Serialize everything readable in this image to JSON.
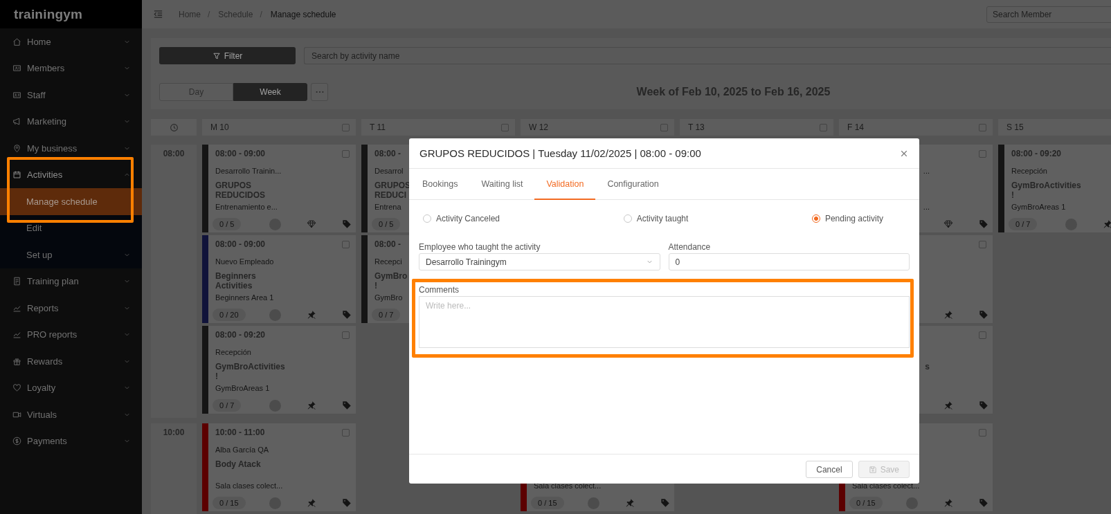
{
  "sidebar": {
    "logo": "trainingym",
    "items": [
      {
        "label": "Home",
        "expanded": false
      },
      {
        "label": "Members",
        "expanded": false
      },
      {
        "label": "Staff",
        "expanded": false
      },
      {
        "label": "Marketing",
        "expanded": false
      },
      {
        "label": "My business",
        "expanded": false
      },
      {
        "label": "Activities",
        "expanded": true,
        "highlighted": true,
        "children": [
          {
            "label": "Manage schedule",
            "selected": true
          },
          {
            "label": "Edit",
            "selected": false
          },
          {
            "label": "Set up",
            "selected": false,
            "expanded": false
          }
        ]
      },
      {
        "label": "Training plan",
        "expanded": false
      },
      {
        "label": "Reports",
        "expanded": false
      },
      {
        "label": "PRO reports",
        "expanded": false
      },
      {
        "label": "Rewards",
        "expanded": false
      },
      {
        "label": "Loyalty",
        "expanded": false
      },
      {
        "label": "Virtuals",
        "expanded": false
      },
      {
        "label": "Payments",
        "expanded": false
      }
    ]
  },
  "topbar": {
    "breadcrumbs": [
      {
        "label": "Home",
        "kind": "link"
      },
      {
        "label": "/",
        "kind": "separator"
      },
      {
        "label": "Schedule",
        "kind": "link"
      },
      {
        "label": "/",
        "kind": "separator"
      },
      {
        "label": "Manage schedule",
        "kind": "current"
      }
    ],
    "search": {
      "placeholder": "Search Member"
    }
  },
  "toolbar": {
    "filter_button": "Filter",
    "search": {
      "placeholder": "Search by activity name"
    },
    "views": [
      {
        "label": "Day",
        "selected": false
      },
      {
        "label": "Week",
        "selected": true
      }
    ],
    "week_title": "Week of Feb 10, 2025 to Feb 16, 2025"
  },
  "calendar": {
    "times": [
      "08:00",
      "10:00"
    ],
    "days": [
      {
        "label": "M 10",
        "checked": false,
        "first_slot": [
          {
            "color": "#151515",
            "checked": false,
            "time": "08:00 - 09:00",
            "trainer": "Desarrollo Trainin...",
            "name": [
              "GRUPOS",
              "REDUCIDOS"
            ],
            "area": "Entrenamiento e...",
            "count": "0 / 5",
            "icons": [
              {
                "kind": "circle"
              },
              {
                "kind": "diamond"
              },
              {
                "kind": "tag"
              }
            ]
          },
          {
            "color": "#10133a",
            "checked": false,
            "time": "08:00 - 09:00",
            "trainer": "Nuevo Empleado",
            "name": [
              "Beginners",
              "Activities"
            ],
            "area": "Beginners Area 1",
            "count": "0 / 20",
            "icons": [
              {
                "kind": "circle"
              },
              {
                "kind": "pin"
              },
              {
                "kind": "tag"
              }
            ]
          },
          {
            "color": "#151515",
            "checked": false,
            "time": "08:00 - 09:20",
            "trainer": "Recepción",
            "name": [
              "GymBroActivities",
              "!"
            ],
            "area": "GymBroAreas 1",
            "count": "0 / 7",
            "icons": [
              {
                "kind": "circle"
              },
              {
                "kind": "pin"
              },
              {
                "kind": "tag"
              }
            ]
          }
        ],
        "second_slot": [
          {
            "color": "#5c0000",
            "checked": false,
            "time": "10:00 - 11:00",
            "trainer": "Alba García QA",
            "name": [
              "Body Atack"
            ],
            "area": "Sala clases colect...",
            "count": "0 / 15",
            "icons": [
              {
                "kind": "circle"
              },
              {
                "kind": "pin"
              },
              {
                "kind": "tag"
              }
            ]
          }
        ]
      },
      {
        "label": "T 11",
        "checked": false,
        "first_slot": [
          {
            "color": "#151515",
            "time": "08:00 -",
            "trainer": "Desarrol",
            "name": [
              "GRUPOS",
              "REDUCI"
            ],
            "area": "Entrena",
            "count": "0 / 5"
          },
          {
            "color": "#151515",
            "time": "08:00 -",
            "trainer": "Recepci",
            "name": [
              "GymBro",
              "!"
            ],
            "area": "GymBro",
            "count": "0 / 7"
          }
        ]
      },
      {
        "label": "W 12",
        "checked": false,
        "second_slot": [
          {
            "color": "#5c0000",
            "area": "Sala clases colect...",
            "count": "0 / 15",
            "icons": [
              {
                "kind": "circle"
              },
              {
                "kind": "pin"
              },
              {
                "kind": "tag"
              }
            ]
          }
        ]
      },
      {
        "label": "T 13",
        "checked": false
      },
      {
        "label": "F 14",
        "checked": false,
        "first_slot": [
          {
            "checked": false,
            "trainer_tail": "...",
            "area_tail": "...",
            "icons": [
              {
                "kind": "diamond"
              },
              {
                "kind": "tag"
              }
            ]
          },
          {
            "checked": false,
            "icons": [
              {
                "kind": "pin"
              },
              {
                "kind": "tag"
              }
            ]
          },
          {
            "checked": false,
            "name_tail": "s",
            "icons": [
              {
                "kind": "pin"
              },
              {
                "kind": "tag"
              }
            ]
          }
        ],
        "second_slot": [
          {
            "color": "#5c0000",
            "checked": false,
            "area": "Sala clases colect...",
            "count": "0 / 15",
            "icons": [
              {
                "kind": "circle"
              },
              {
                "kind": "pin"
              },
              {
                "kind": "tag"
              }
            ]
          }
        ]
      },
      {
        "label": "S 15",
        "first_slot": [
          {
            "color": "#151515",
            "time": "08:00 - 09:20",
            "trainer": "Recepción",
            "name": [
              "GymBroActivities",
              "!"
            ],
            "area": "GymBroAreas 1",
            "count": "0 / 7",
            "icons": [
              {
                "kind": "circle"
              },
              {
                "kind": "pin"
              }
            ]
          }
        ]
      }
    ]
  },
  "dialog": {
    "title": "GRUPOS REDUCIDOS | Tuesday 11/02/2025 | 08:00 - 09:00",
    "tabs": [
      {
        "label": "Bookings",
        "selected": false
      },
      {
        "label": "Waiting list",
        "selected": false
      },
      {
        "label": "Validation",
        "selected": true
      },
      {
        "label": "Configuration",
        "selected": false
      }
    ],
    "status_options": [
      {
        "label": "Activity Canceled",
        "selected": false
      },
      {
        "label": "Activity taught",
        "selected": false
      },
      {
        "label": "Pending activity",
        "selected": true
      }
    ],
    "employee": {
      "label": "Employee who taught the activity",
      "value": "Desarrollo Trainingym"
    },
    "attendance": {
      "label": "Attendance",
      "value": "0"
    },
    "comments": {
      "label": "Comments",
      "placeholder": "Write here...",
      "highlighted": true
    },
    "buttons": [
      {
        "label": "Cancel",
        "kind": "cancel",
        "disabled": false
      },
      {
        "label": "Save",
        "kind": "save",
        "disabled": true
      }
    ]
  }
}
